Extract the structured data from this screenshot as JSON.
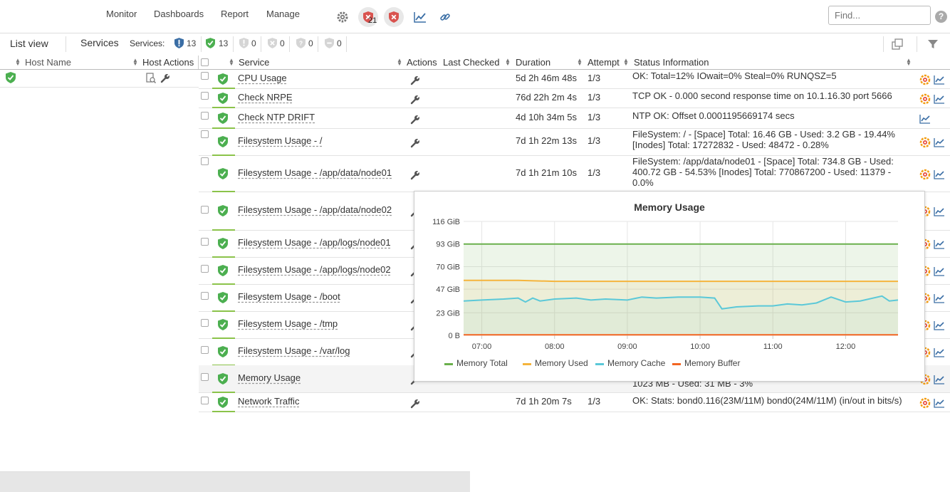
{
  "topnav": {
    "monitor": "Monitor",
    "dashboards": "Dashboards",
    "report": "Report",
    "manage": "Manage",
    "alert_count": "21",
    "find_placeholder": "Find...",
    "help": "?"
  },
  "subbar": {
    "list_view": "List view",
    "services_tab": "Services",
    "services_label": "Services:",
    "counts": {
      "all": "13",
      "ok": "13",
      "warning": "0",
      "critical": "0",
      "unknown": "0",
      "pending": "0"
    }
  },
  "table": {
    "headers": {
      "host_name": "Host Name",
      "host_actions": "Host Actions",
      "service": "Service",
      "actions": "Actions",
      "last_checked": "Last Checked",
      "duration": "Duration",
      "attempt": "Attempt",
      "status_information": "Status Information"
    },
    "rows": [
      {
        "service": "CPU Usage",
        "duration": "5d 2h 46m 48s",
        "attempt": "1/3",
        "status": [
          "OK: Total=12% IOwait=0% Steal=0% RUNQSZ=5"
        ]
      },
      {
        "service": "Check NRPE",
        "duration": "76d 22h 2m 4s",
        "attempt": "1/3",
        "status": [
          "TCP OK - 0.000 second response time on 10.1.16.30 port 5666"
        ]
      },
      {
        "service": "Check NTP DRIFT",
        "duration": "4d 10h 34m 5s",
        "attempt": "1/3",
        "status": [
          "NTP OK: Offset 0.0001195669174 secs"
        ]
      },
      {
        "service": "Filesystem Usage - /",
        "duration": "7d 1h 22m 13s",
        "attempt": "1/3",
        "status": [
          "FileSystem: / - [Space] Total: 16.46 GB - Used: 3.2 GB - 19.44%",
          "[Inodes] Total: 17272832 - Used: 48472 - 0.28%"
        ]
      },
      {
        "service": "Filesystem Usage - /app/data/node01",
        "duration": "7d 1h 21m 10s",
        "attempt": "1/3",
        "status": [
          "FileSystem: /app/data/node01 - [Space] Total: 734.8 GB - Used:",
          "400.72 GB - 54.53% [Inodes] Total: 770867200 - Used: 11379 -",
          "0.0%"
        ]
      },
      {
        "service": "Filesystem Usage - /app/data/node02",
        "duration": "",
        "attempt": "",
        "status": []
      },
      {
        "service": "Filesystem Usage - /app/logs/node01",
        "duration": "",
        "attempt": "",
        "status": []
      },
      {
        "service": "Filesystem Usage - /app/logs/node02",
        "duration": "",
        "attempt": "",
        "status": []
      },
      {
        "service": "Filesystem Usage - /boot",
        "duration": "",
        "attempt": "",
        "status": []
      },
      {
        "service": "Filesystem Usage - /tmp",
        "duration": "",
        "attempt": "",
        "status": []
      },
      {
        "service": "Filesystem Usage - /var/log",
        "duration": "",
        "attempt": "",
        "status": []
      },
      {
        "service": "Memory Usage",
        "duration": "",
        "attempt": "",
        "status": [
          "1023 MB - Used: 31 MB - 3%"
        ]
      },
      {
        "service": "Network Traffic",
        "duration": "7d 1h 20m 7s",
        "attempt": "1/3",
        "status": [
          "OK: Stats: bond0.116(23M/11M) bond0(24M/11M) (in/out in bits/s)"
        ]
      }
    ]
  },
  "colors": {
    "ok_green": "#4caf50",
    "accent_blue": "#3a6ea5",
    "alert_red": "#d9534f"
  },
  "chart_data": {
    "type": "area",
    "title": "Memory Usage",
    "y_tick_labels": [
      "116 GiB",
      "93 GiB",
      "70 GiB",
      "47 GiB",
      "23 GiB",
      "0 B"
    ],
    "x_tick_labels": [
      "07:00",
      "08:00",
      "09:00",
      "10:00",
      "11:00",
      "12:00"
    ],
    "ylim": [
      0,
      116
    ],
    "xlim": [
      6.75,
      12.72
    ],
    "series": [
      {
        "name": "Memory Total",
        "color": "#6ab04c",
        "x": [
          6.75,
          12.72
        ],
        "values": [
          93,
          93
        ]
      },
      {
        "name": "Memory Used",
        "color": "#f5b43c",
        "x": [
          6.75,
          7.5,
          8.0,
          9.0,
          10.0,
          11.0,
          12.0,
          12.72
        ],
        "values": [
          56,
          56,
          55,
          55,
          55,
          55,
          55,
          55
        ]
      },
      {
        "name": "Memory Cache",
        "color": "#5bc8d8",
        "x": [
          6.75,
          7.0,
          7.3,
          7.5,
          7.6,
          7.7,
          7.8,
          8.0,
          8.3,
          8.5,
          8.7,
          9.0,
          9.2,
          9.4,
          9.7,
          10.0,
          10.2,
          10.3,
          10.5,
          10.8,
          11.0,
          11.2,
          11.4,
          11.6,
          11.8,
          12.0,
          12.2,
          12.5,
          12.6,
          12.72
        ],
        "values": [
          35,
          36,
          37,
          38,
          34,
          38,
          35,
          37,
          38,
          36,
          37,
          36,
          39,
          38,
          39,
          39,
          38,
          27,
          29,
          30,
          30,
          32,
          31,
          33,
          39,
          34,
          35,
          40,
          35,
          36
        ]
      },
      {
        "name": "Memory Buffer",
        "color": "#f26522",
        "x": [
          6.75,
          12.72
        ],
        "values": [
          0.5,
          0.5
        ]
      }
    ],
    "legend": "bottom"
  }
}
